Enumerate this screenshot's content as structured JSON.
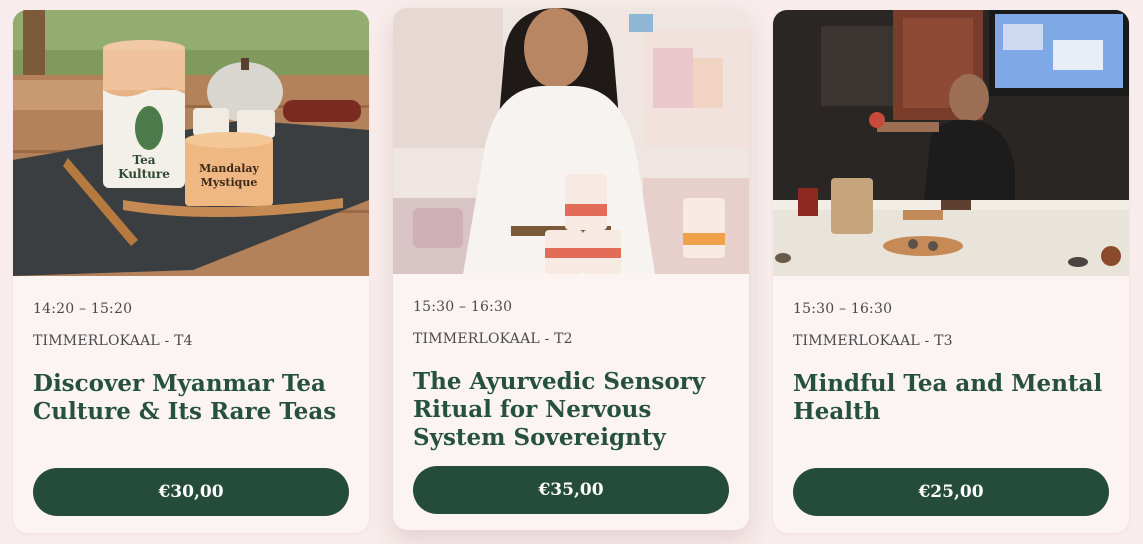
{
  "workshops": [
    {
      "time": "14:20 – 15:20",
      "location": "TIMMERLOKAAL - T4",
      "title": "Discover Myanmar Tea Culture & Its Rare Teas",
      "price": "€30,00",
      "image_text": {
        "brand_top": "Tea",
        "brand_bottom": "Kulture",
        "product_line1": "Mandalay",
        "product_line2": "Mystique"
      }
    },
    {
      "time": "15:30 – 16:30",
      "location": "TIMMERLOKAAL - T2",
      "title": "The Ayurvedic Sensory Ritual for Nervous System Sovereignty",
      "price": "€35,00"
    },
    {
      "time": "15:30 – 16:30",
      "location": "TIMMERLOKAAL - T3",
      "title": "Mindful Tea and Mental Health",
      "price": "€25,00"
    }
  ],
  "colors": {
    "page_background": "#f8edec",
    "card_background": "#fcf4f3",
    "title": "#27513f",
    "button": "#254c3a",
    "button_text": "#ffffff"
  }
}
